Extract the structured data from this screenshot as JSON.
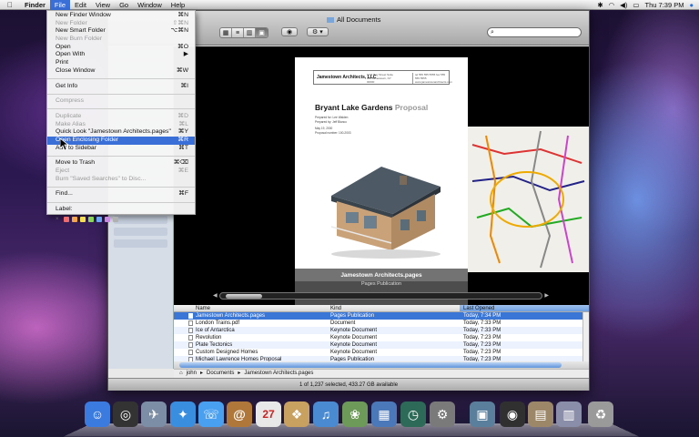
{
  "menubar": {
    "app": "Finder",
    "menus": [
      "File",
      "Edit",
      "View",
      "Go",
      "Window",
      "Help"
    ],
    "active_menu": "File",
    "clock": "Thu 7:39 PM",
    "status_icons": [
      "bluetooth-icon",
      "wifi-icon",
      "volume-icon",
      "battery-icon",
      "spotlight-icon"
    ]
  },
  "window": {
    "title": "All Documents",
    "search_placeholder": "",
    "view_buttons": [
      "icon-view",
      "list-view",
      "column-view",
      "coverflow-view"
    ],
    "quicklook_label": "◉",
    "action_label": "⚙ ▾"
  },
  "file_menu": {
    "items": [
      {
        "label": "New Finder Window",
        "shortcut": "⌘N",
        "enabled": true
      },
      {
        "label": "New Folder",
        "shortcut": "⇧⌘N",
        "enabled": false
      },
      {
        "label": "New Smart Folder",
        "shortcut": "⌥⌘N",
        "enabled": true
      },
      {
        "label": "New Burn Folder",
        "shortcut": "",
        "enabled": false
      },
      {
        "label": "Open",
        "shortcut": "⌘O",
        "enabled": true
      },
      {
        "label": "Open With",
        "shortcut": "▶",
        "enabled": true
      },
      {
        "label": "Print",
        "shortcut": "",
        "enabled": true
      },
      {
        "label": "Close Window",
        "shortcut": "⌘W",
        "enabled": true
      },
      {
        "sep": true
      },
      {
        "label": "Get Info",
        "shortcut": "⌘I",
        "enabled": true
      },
      {
        "sep": true
      },
      {
        "label": "Compress",
        "shortcut": "",
        "enabled": false
      },
      {
        "sep": true
      },
      {
        "label": "Duplicate",
        "shortcut": "⌘D",
        "enabled": false
      },
      {
        "label": "Make Alias",
        "shortcut": "⌘L",
        "enabled": false
      },
      {
        "label": "Quick Look \"Jamestown Architects.pages\"",
        "shortcut": "⌘Y",
        "enabled": true
      },
      {
        "label": "Open Enclosing Folder",
        "shortcut": "⌘R",
        "enabled": true,
        "highlighted": true
      },
      {
        "label": "Add to Sidebar",
        "shortcut": "⌘T",
        "enabled": true
      },
      {
        "sep": true
      },
      {
        "label": "Move to Trash",
        "shortcut": "⌘⌫",
        "enabled": true
      },
      {
        "label": "Eject",
        "shortcut": "⌘E",
        "enabled": false
      },
      {
        "label": "Burn \"Saved Searches\" to Disc...",
        "shortcut": "",
        "enabled": false
      },
      {
        "sep": true
      },
      {
        "label": "Find...",
        "shortcut": "⌘F",
        "enabled": true
      },
      {
        "sep": true
      },
      {
        "label": "Label:",
        "shortcut": "",
        "enabled": true
      }
    ],
    "label_none": "×",
    "label_colors": [
      "#f06b6b",
      "#f5a54a",
      "#f4e04e",
      "#8ad45c",
      "#6aa6f2",
      "#c58ae0",
      "#b0b0b0"
    ]
  },
  "preview": {
    "company": "Jamestown Architects, LLC",
    "address": "1011 Bay Street Suite 100 Jamestown, NY 00000",
    "contact": "tel 555 555 5555 fax 555 555 5555 www.jamestownarchitects.com",
    "title_main": "Bryant Lake Gardens",
    "title_light": "Proposal",
    "meta_line1": "Prepared for: Lee Walden",
    "meta_line2": "Prepared by: Jeff Blanco",
    "meta_line3": "May 19, 2000",
    "meta_line4": "Proposal number: 100-2003",
    "caption_name": "Jamestown Architects.pages",
    "caption_kind": "Pages Publication"
  },
  "list": {
    "headers": {
      "name": "Name",
      "kind": "Kind",
      "date": "Last Opened"
    },
    "rows": [
      {
        "name": "Jamestown Architects.pages",
        "kind": "Pages Publication",
        "date": "Today, 7:34 PM",
        "selected": true
      },
      {
        "name": "London Trains.pdf",
        "kind": "Document",
        "date": "Today, 7:33 PM"
      },
      {
        "name": "Ice of Antarctica",
        "kind": "Keynote Document",
        "date": "Today, 7:33 PM"
      },
      {
        "name": "Revolution",
        "kind": "Keynote Document",
        "date": "Today, 7:23 PM"
      },
      {
        "name": "Plate Tectonics",
        "kind": "Keynote Document",
        "date": "Today, 7:23 PM"
      },
      {
        "name": "Custom Designed Homes",
        "kind": "Keynote Document",
        "date": "Today, 7:23 PM"
      },
      {
        "name": "Michael Lawrence Homes Proposal",
        "kind": "Pages Publication",
        "date": "Today, 7:23 PM"
      }
    ]
  },
  "pathbar": [
    "john",
    "Documents",
    "Jamestown Architects.pages"
  ],
  "status": "1 of 1,237 selected, 433.27 GB available",
  "dock": [
    {
      "name": "finder-icon",
      "color": "#3b7be0"
    },
    {
      "name": "dashboard-icon",
      "color": "#333333"
    },
    {
      "name": "mail-icon",
      "color": "#7c8ea6"
    },
    {
      "name": "safari-icon",
      "color": "#3a8ee0"
    },
    {
      "name": "ichat-icon",
      "color": "#4aa0f0"
    },
    {
      "name": "addressbook-icon",
      "color": "#b0773a"
    },
    {
      "name": "ical-icon",
      "color": "#e8e8e8"
    },
    {
      "name": "preview-icon",
      "color": "#c8a060"
    },
    {
      "name": "itunes-icon",
      "color": "#4a8ad0"
    },
    {
      "name": "iphoto-icon",
      "color": "#6d9a58"
    },
    {
      "name": "spaces-icon",
      "color": "#4b78b8"
    },
    {
      "name": "timemachine-icon",
      "color": "#2d6a58"
    },
    {
      "name": "systempreferences-icon",
      "color": "#7a7a7a"
    },
    {
      "name": "pictures-stack-icon",
      "color": "#5a7f9c"
    },
    {
      "name": "photobooth-icon",
      "color": "#303030"
    },
    {
      "name": "documents-stack-icon",
      "color": "#9c8868"
    },
    {
      "name": "downloads-stack-icon",
      "color": "#8a8ea8"
    },
    {
      "name": "trash-icon",
      "color": "#9a9a9a"
    }
  ],
  "calendar_day": "27"
}
